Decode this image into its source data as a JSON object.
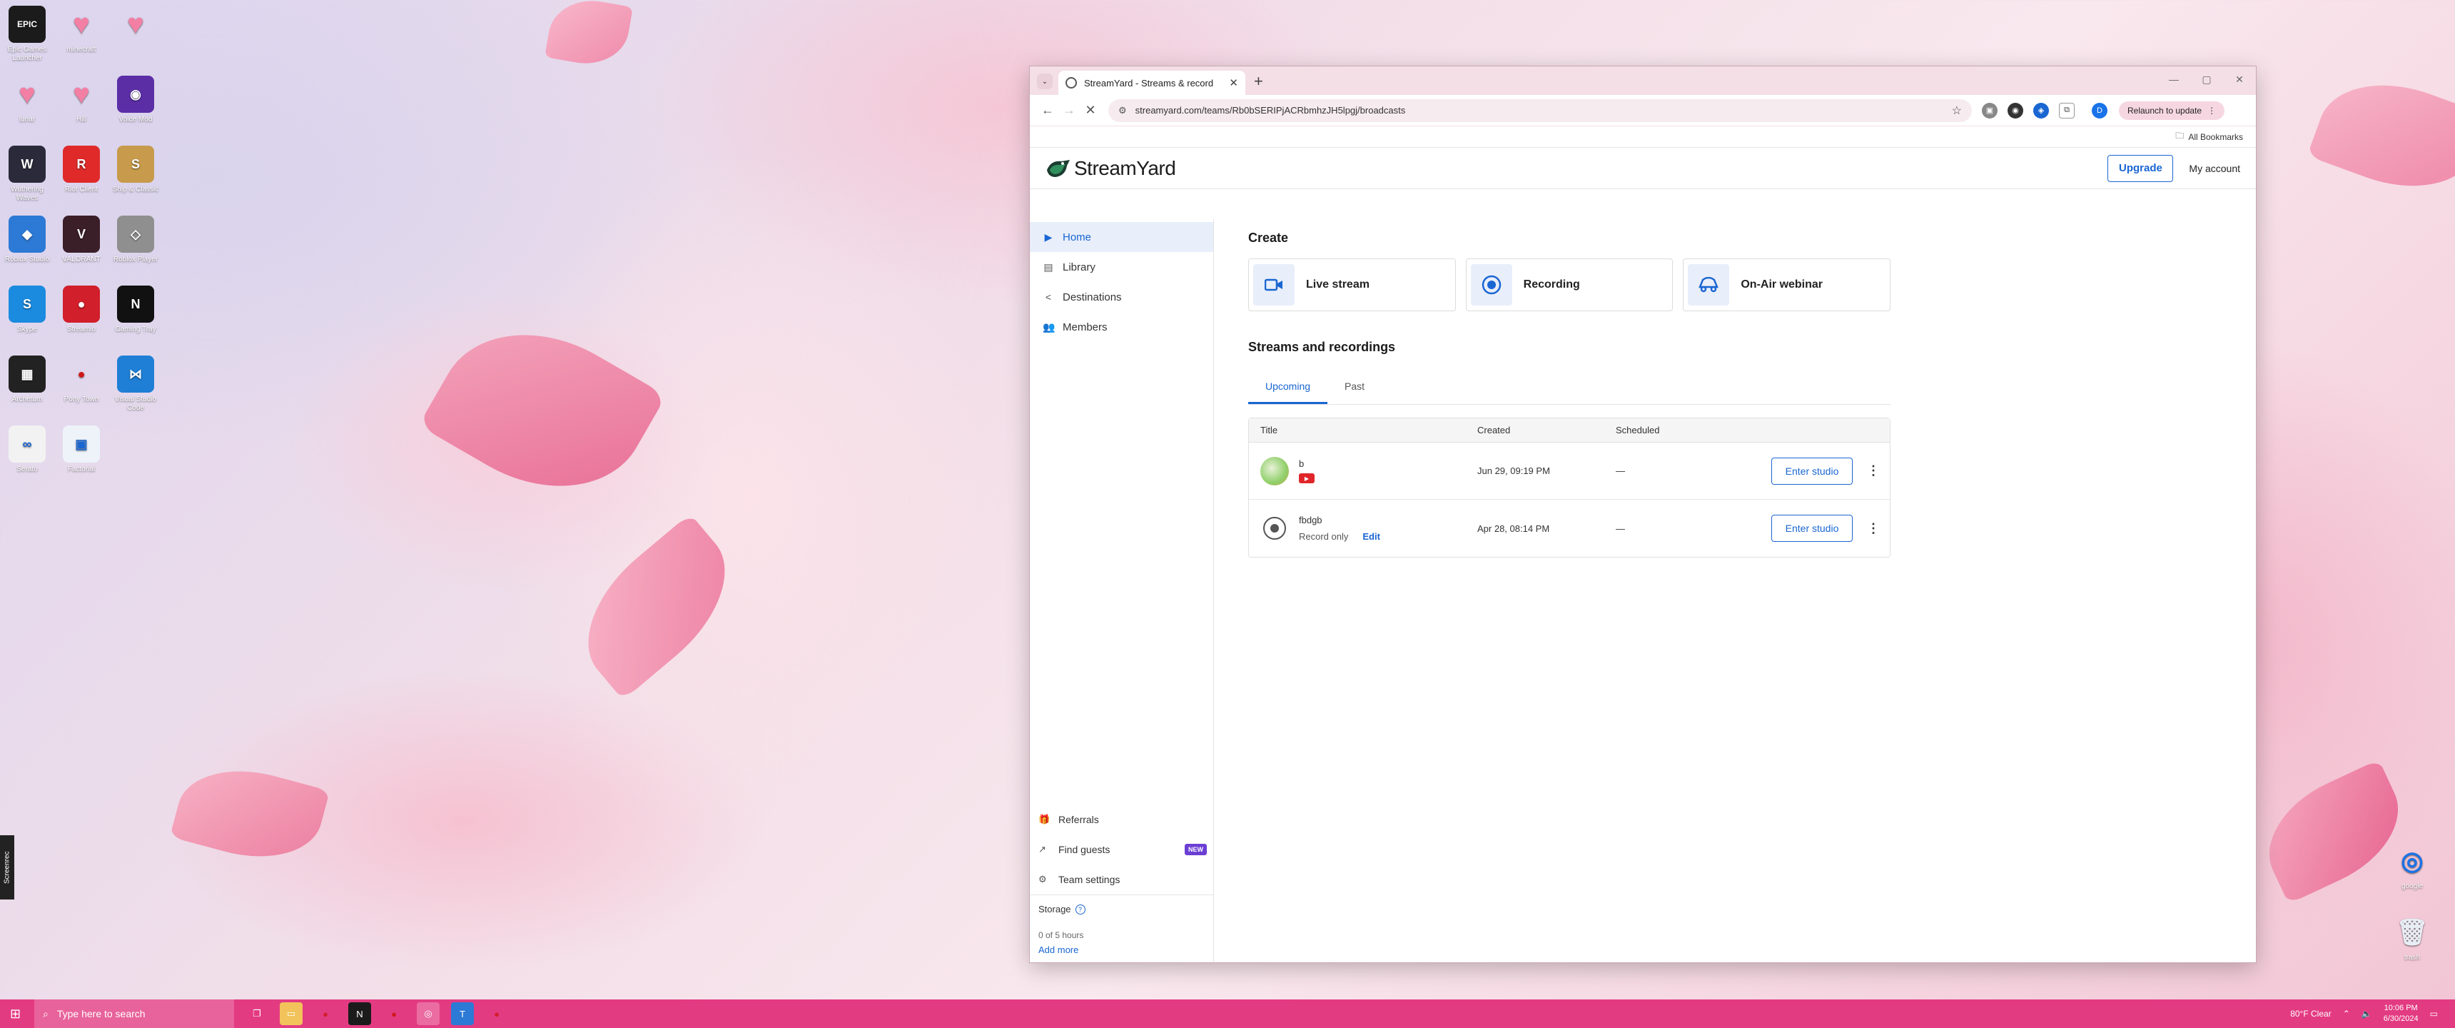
{
  "desktop": {
    "icons": [
      {
        "label": "Epic Games Launcher",
        "glyph": "EPIC",
        "bg": "#1b1b1b"
      },
      {
        "label": "minecraft",
        "glyph": "♥",
        "bg": "transparent",
        "fg": "#f47fa4"
      },
      {
        "label": "",
        "glyph": "♥",
        "bg": "transparent",
        "fg": "#f47fa4"
      },
      {
        "label": "lunar",
        "glyph": "♥",
        "bg": "transparent",
        "fg": "#f47fa4"
      },
      {
        "label": "Hill",
        "glyph": "♥",
        "bg": "transparent",
        "fg": "#f47fa4"
      },
      {
        "label": "Voice Mod",
        "glyph": "◉",
        "bg": "#5b2ea6"
      },
      {
        "label": "Wuthering Waves",
        "glyph": "W",
        "bg": "#2a2a3a"
      },
      {
        "label": "Riot Client",
        "glyph": "R",
        "bg": "#e02a2a"
      },
      {
        "label": "Ship & Classic",
        "glyph": "S",
        "bg": "#c79b4b"
      },
      {
        "label": "Roblox Studio",
        "glyph": "◆",
        "bg": "#2c7ad6"
      },
      {
        "label": "VALORANT",
        "glyph": "V",
        "bg": "#3a1e28"
      },
      {
        "label": "Roblox Player",
        "glyph": "◇",
        "bg": "#8f8f8f"
      },
      {
        "label": "Skype",
        "glyph": "S",
        "bg": "#1b8be0"
      },
      {
        "label": "Streamio",
        "glyph": "●",
        "bg": "#d11f2b"
      },
      {
        "label": "Gaming Tray",
        "glyph": "N",
        "bg": "#111"
      },
      {
        "label": "Archetum",
        "glyph": "▦",
        "bg": "#222"
      },
      {
        "label": "Pony Town",
        "glyph": "●",
        "bg": "transparent",
        "fg": "#d01818"
      },
      {
        "label": "Visual Studio Code",
        "glyph": "⋈",
        "bg": "#1f7fd6"
      },
      {
        "label": "Serato",
        "glyph": "∞",
        "bg": "#f2f2f2",
        "fg": "#1a66d2"
      },
      {
        "label": "Factorial",
        "glyph": "▣",
        "bg": "#eef3fa",
        "fg": "#1a66d2"
      }
    ],
    "right_icons": [
      {
        "label": "google",
        "glyph": "◎"
      },
      {
        "label": "trash",
        "glyph": "🗑"
      }
    ],
    "screenrec_label": "Screenrec"
  },
  "browser": {
    "tab_title": "StreamYard - Streams & record",
    "url": "streamyard.com/teams/Rb0bSERIPjACRbmhzJH5lpgj/broadcasts",
    "relaunch_label": "Relaunch to update",
    "bookmarks_label": "All Bookmarks",
    "profile_initial": "D"
  },
  "page": {
    "logo_text": "StreamYard",
    "upgrade_label": "Upgrade",
    "my_account_label": "My account",
    "sidebar": [
      {
        "label": "Home",
        "icon": "▶",
        "active": true
      },
      {
        "label": "Library",
        "icon": "▤",
        "active": false
      },
      {
        "label": "Destinations",
        "icon": "<",
        "active": false
      },
      {
        "label": "Members",
        "icon": "👥",
        "active": false
      }
    ],
    "sidebar_bottom": {
      "referrals": "Referrals",
      "find_guests": "Find guests",
      "new_badge": "NEW",
      "team_settings": "Team settings",
      "storage_label": "Storage",
      "storage_usage": "0 of 5 hours",
      "add_more": "Add more"
    },
    "create_heading": "Create",
    "create_cards": [
      {
        "label": "Live stream",
        "icon": "video-icon"
      },
      {
        "label": "Recording",
        "icon": "record-icon"
      },
      {
        "label": "On-Air webinar",
        "icon": "webinar-icon"
      }
    ],
    "streams_heading": "Streams and recordings",
    "tabs": [
      {
        "label": "Upcoming",
        "active": true
      },
      {
        "label": "Past",
        "active": false
      }
    ],
    "table": {
      "headers": [
        "Title",
        "Created",
        "Scheduled"
      ],
      "rows": [
        {
          "title": "b",
          "subtitle": "",
          "created": "Jun 29, 09:19 PM",
          "scheduled": "—",
          "action": "Enter studio",
          "type": "stream"
        },
        {
          "title": "fbdgb",
          "subtitle": "Record only",
          "edit": "Edit",
          "created": "Apr 28, 08:14 PM",
          "scheduled": "—",
          "action": "Enter studio",
          "type": "recording"
        }
      ]
    }
  },
  "taskbar": {
    "search_placeholder": "Type here to search",
    "weather": "80°F  Clear",
    "time": "10:06 PM",
    "date": "6/30/2024"
  }
}
